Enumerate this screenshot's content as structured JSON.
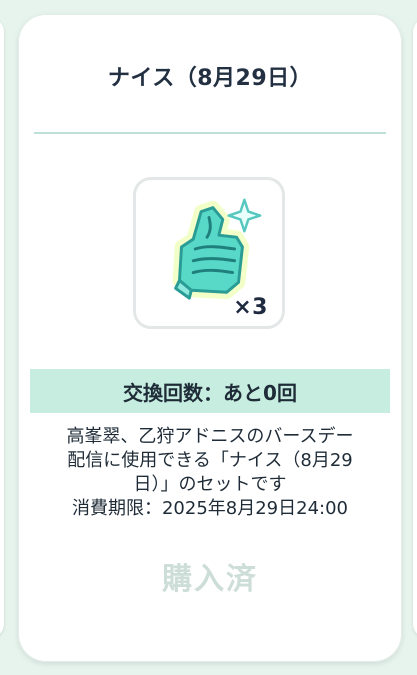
{
  "card": {
    "title": "ナイス（8月29日）",
    "item": {
      "icon": "thumbs-up-sparkle-icon",
      "quantity_label": "×3"
    },
    "exchange_count_label": "交換回数：あと0回",
    "description_lines": [
      "高峯翠、乙狩アドニスのバースデー",
      "配信に使用できる「ナイス（8月29",
      "日）」のセットです",
      "消費期限：2025年8月29日24:00"
    ],
    "purchase_status": "購入済"
  },
  "colors": {
    "background": "#e7f4ee",
    "card": "#ffffff",
    "band": "#c6ede0",
    "text": "#1f2c38",
    "divider": "#bfe0d8",
    "disabled_text": "#cdddd7",
    "icon_fill": "#56d8c6",
    "icon_glow": "#f3ffc8"
  }
}
